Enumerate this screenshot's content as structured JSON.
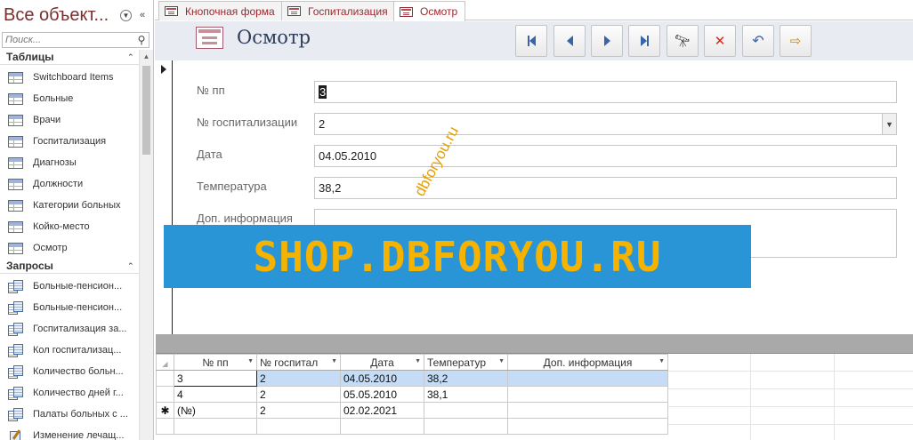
{
  "nav": {
    "title": "Все объект...",
    "search_placeholder": "Поиск...",
    "groups": [
      {
        "label": "Таблицы",
        "items": [
          "Switchboard Items",
          "Больные",
          "Врачи",
          "Госпитализация",
          "Диагнозы",
          "Должности",
          "Категории больных",
          "Койко-место",
          "Осмотр"
        ]
      },
      {
        "label": "Запросы",
        "items": [
          "Больные-пенсион...",
          "Больные-пенсион...",
          "Госпитализация за...",
          "Кол госпитализац...",
          "Количество больн...",
          "Количество дней г...",
          "Палаты больных с ...",
          "Изменение лечащ..."
        ]
      }
    ]
  },
  "tabs": [
    {
      "label": "Кнопочная форма"
    },
    {
      "label": "Госпитализация"
    },
    {
      "label": "Осмотр"
    }
  ],
  "form": {
    "title": "Осмотр",
    "toolbar": [
      "first-record-icon",
      "prev-record-icon",
      "next-record-icon",
      "last-record-icon",
      "find-icon",
      "delete-icon",
      "undo-icon",
      "close-form-icon"
    ],
    "fields": {
      "num_label": "№ пп",
      "num_value": "3",
      "hosp_label": "№ госпитализации",
      "hosp_value": "2",
      "date_label": "Дата",
      "date_value": "04.05.2010",
      "temp_label": "Температура",
      "temp_value": "38,2",
      "info_label": "Доп. информация",
      "info_value": ""
    }
  },
  "watermark": {
    "main": "SHOP.DBFORYOU.RU",
    "diagonal": "dbforyou.ru"
  },
  "sheet": {
    "columns": [
      "№ пп",
      "№ госпитал",
      "Дата",
      "Температур",
      "Доп. информация"
    ],
    "rows": [
      [
        "3",
        "2",
        "04.05.2010",
        "38,2",
        ""
      ],
      [
        "4",
        "2",
        "05.05.2010",
        "38,1",
        ""
      ],
      [
        "(№)",
        "2",
        "02.02.2021",
        "",
        ""
      ]
    ],
    "new_row_marker": "✱"
  },
  "colors": {
    "accent": "#a0282d",
    "header_bg": "#e8ecf2",
    "watermark_bg": "#2a95d6",
    "watermark_text": "#f5b300",
    "current_row": "#c4dcf5"
  }
}
